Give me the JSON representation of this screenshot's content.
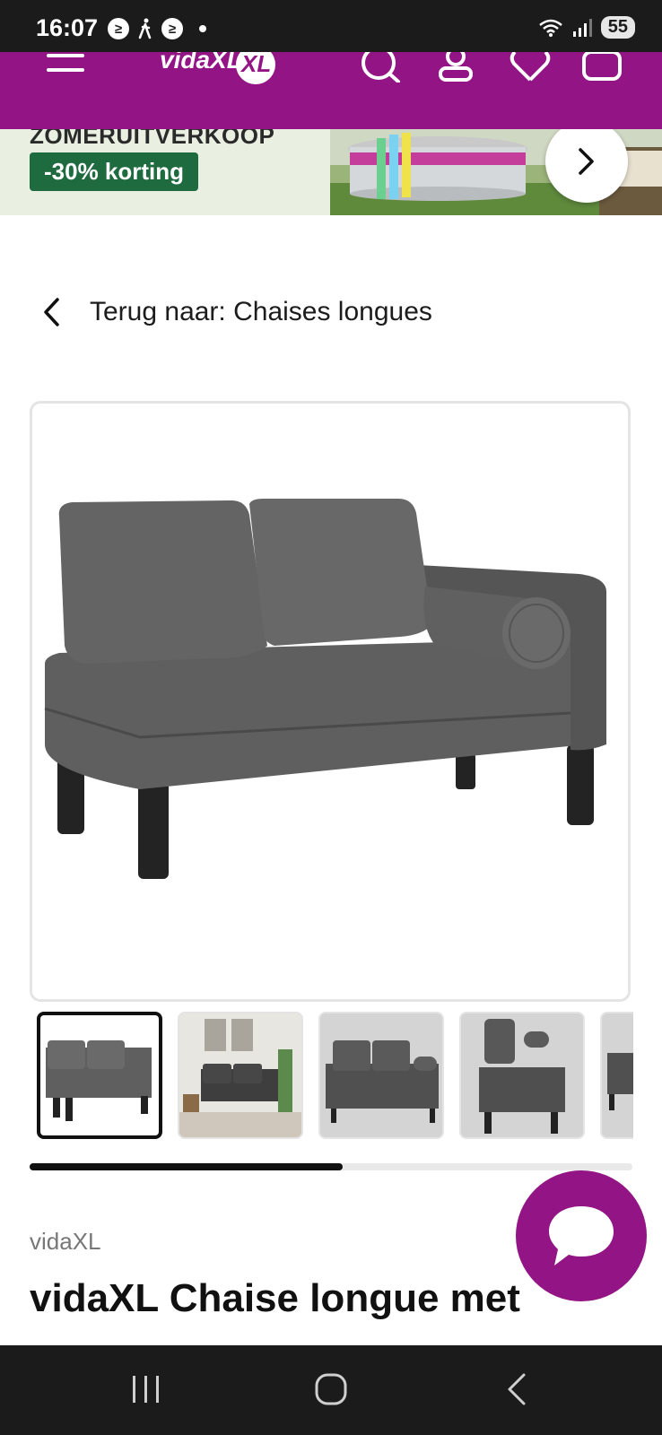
{
  "status_bar": {
    "time": "16:07",
    "battery": "55"
  },
  "header": {
    "logo_text": "vidaXL",
    "brand_color": "#931585"
  },
  "promo": {
    "title": "ZOMERUITVERKOOP",
    "badge": "-30% korting"
  },
  "back_link": {
    "label": "Terug naar: Chaises longues"
  },
  "gallery": {
    "thumbnail_count": 5,
    "active_index": 0,
    "scroll_fraction": 0.52
  },
  "product": {
    "brand": "vidaXL",
    "title": "vidaXL Chaise longue met"
  },
  "colors": {
    "promo_badge": "#1f6b40",
    "sofa": "#5a5a5a"
  }
}
